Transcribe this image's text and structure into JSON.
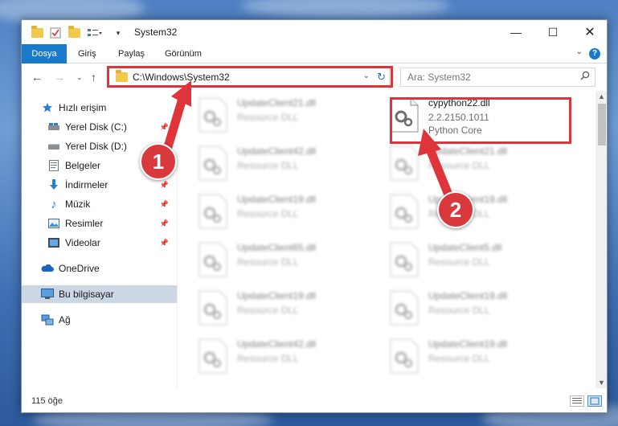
{
  "window": {
    "title": "System32",
    "tabs": [
      "Dosya",
      "Giriş",
      "Paylaş",
      "Görünüm"
    ],
    "help_label": "?"
  },
  "navigation": {
    "address": "C:\\Windows\\System32",
    "search_placeholder": "Ara: System32"
  },
  "sidebar": {
    "items": [
      {
        "label": "Hızlı erişim",
        "icon": "star-icon"
      },
      {
        "label": "Yerel Disk (C:)",
        "icon": "drive-icon"
      },
      {
        "label": "Yerel Disk (D:)",
        "icon": "drive-icon"
      },
      {
        "label": "Belgeler",
        "icon": "documents-icon"
      },
      {
        "label": "İndirmeler",
        "icon": "download-icon"
      },
      {
        "label": "Müzik",
        "icon": "music-icon"
      },
      {
        "label": "Resimler",
        "icon": "pictures-icon"
      },
      {
        "label": "Videolar",
        "icon": "videos-icon"
      },
      {
        "label": "OneDrive",
        "icon": "cloud-icon"
      },
      {
        "label": "Bu bilgisayar",
        "icon": "computer-icon"
      },
      {
        "label": "Ağ",
        "icon": "network-icon"
      }
    ]
  },
  "files": {
    "left": [
      {
        "name": "UpdateClient21.dll",
        "desc": "Resource DLL"
      },
      {
        "name": "UpdateClient42.dll",
        "desc": "Resource DLL"
      },
      {
        "name": "UpdateClient19.dll",
        "desc": "Resource DLL"
      },
      {
        "name": "UpdateClient65.dll",
        "desc": "Resource DLL"
      },
      {
        "name": "UpdateClient19.dll",
        "desc": "Resource DLL"
      },
      {
        "name": "UpdateClient42.dll",
        "desc": "Resource DLL"
      }
    ],
    "highlighted": {
      "name": "cypython22.dll",
      "version": "2.2.2150.1011",
      "desc": "Python Core"
    },
    "right": [
      {
        "name": "UpdateClient21.dll",
        "desc": "Resource DLL"
      },
      {
        "name": "UpdateClient19.dll",
        "desc": "Resource DLL"
      },
      {
        "name": "UpdateClient5.dll",
        "desc": "Resource DLL"
      },
      {
        "name": "UpdateClient19.dll",
        "desc": "Resource DLL"
      },
      {
        "name": "UpdateClient19.dll",
        "desc": "Resource DLL"
      }
    ]
  },
  "status": {
    "count": "115 öğe"
  },
  "annotations": {
    "badge1": "1",
    "badge2": "2",
    "color": "#e0343b"
  }
}
